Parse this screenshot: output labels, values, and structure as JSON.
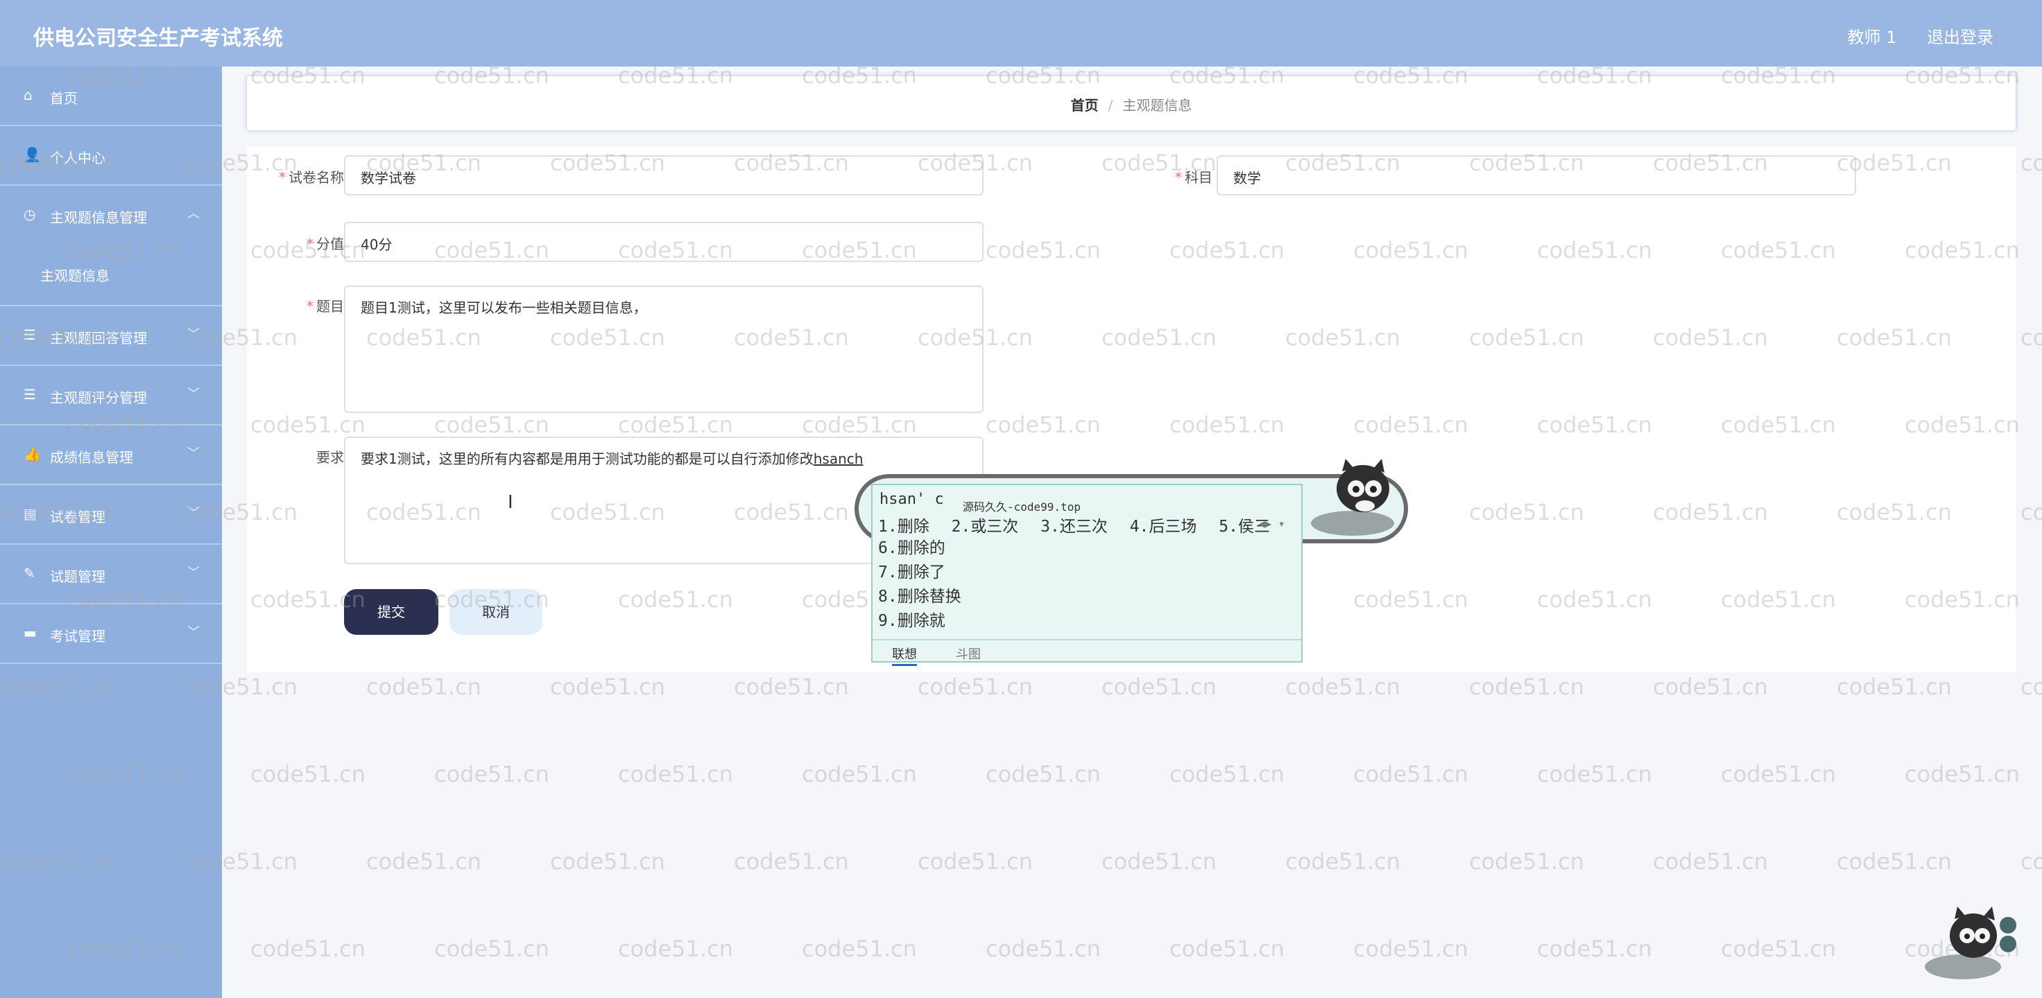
{
  "header": {
    "title": "供电公司安全生产考试系统",
    "user": "教师 1",
    "logout": "退出登录"
  },
  "sidebar": {
    "items": [
      {
        "label": "首页",
        "icon": "home-icon"
      },
      {
        "label": "个人中心",
        "icon": "user-icon"
      },
      {
        "label": "主观题信息管理",
        "icon": "clock-icon",
        "children": [
          "主观题信息"
        ]
      },
      {
        "label": "主观题回答管理",
        "icon": "list-icon"
      },
      {
        "label": "主观题评分管理",
        "icon": "list-icon"
      },
      {
        "label": "成绩信息管理",
        "icon": "thumb-icon"
      },
      {
        "label": "试卷管理",
        "icon": "doc-icon"
      },
      {
        "label": "试题管理",
        "icon": "edit-icon"
      },
      {
        "label": "考试管理",
        "icon": "chat-icon"
      }
    ]
  },
  "breadcrumb": {
    "home": "首页",
    "separator": "/",
    "current": "主观题信息"
  },
  "form": {
    "paper_name_label": "试卷名称",
    "paper_name_value": "数学试卷",
    "subject_label": "科目",
    "subject_value": "数学",
    "score_label": "分值",
    "score_value": "40分",
    "question_label": "题目",
    "question_value": "题目1测试，这里可以发布一些相关题目信息，",
    "requirement_label": "要求",
    "requirement_value": "要求1测试，这里的所有内容都是用用于测试功能的都是可以自行添加修改",
    "requirement_composing": "hsanch",
    "submit": "提交",
    "cancel": "取消"
  },
  "ime": {
    "input": "hsan' c",
    "ad": "源码久久-code99.top",
    "candidates_row": [
      "1.删除",
      "2.或三次",
      "3.还三次",
      "4.后三场",
      "5.侯三"
    ],
    "candidates_list": [
      "6.删除的",
      "7.删除了",
      "8.删除替换",
      "9.删除就"
    ],
    "tab_1": "联想",
    "tab_2": "斗图"
  },
  "watermark": "code51.cn",
  "colors": {
    "header_bg": "#99b7e2",
    "sidebar_bg": "#8fb0de",
    "submit_bg": "#2b3050",
    "cancel_bg": "#e3eefb",
    "required": "#f56c6c"
  }
}
